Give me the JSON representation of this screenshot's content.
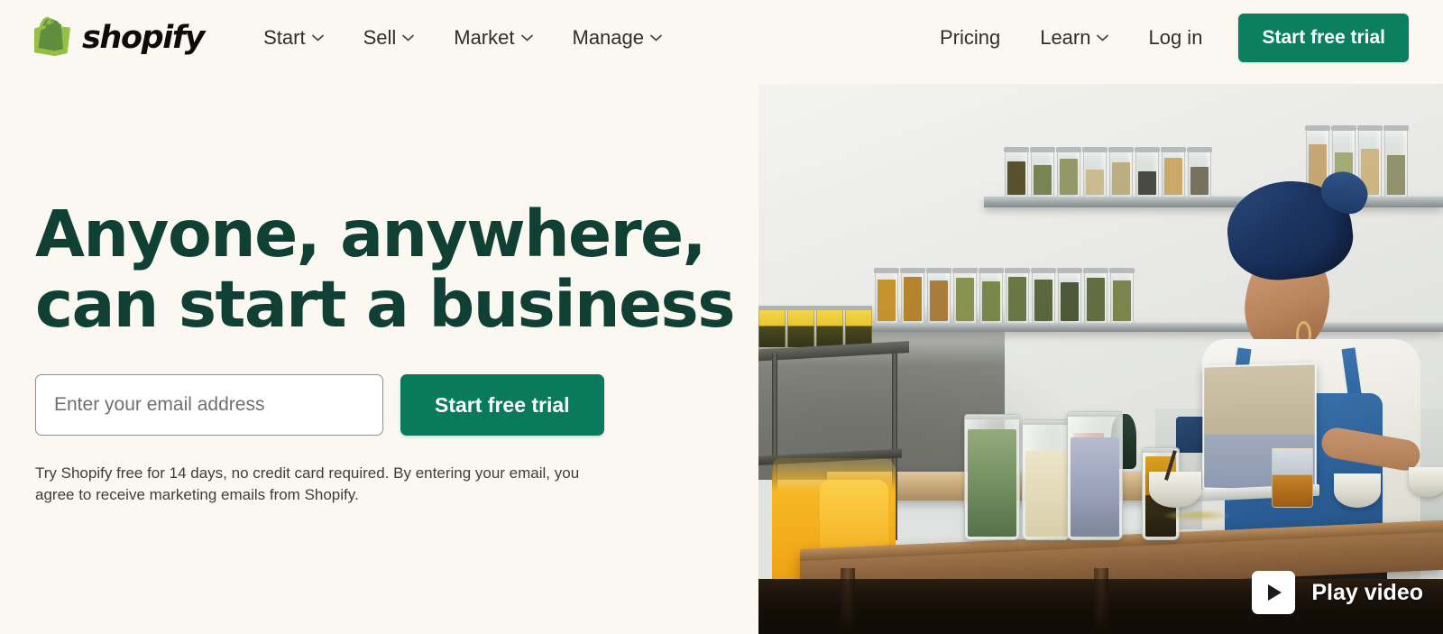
{
  "brand": {
    "name": "shopify",
    "logo_icon": "shopify-bag-icon",
    "accent_green": "#0a8060",
    "hero_button_green": "#0a7a5c",
    "headline_green": "#103f34",
    "page_background": "#faf8f1"
  },
  "nav": {
    "main_items": [
      {
        "label": "Start",
        "has_dropdown": true,
        "icon": "chevron-down-icon"
      },
      {
        "label": "Sell",
        "has_dropdown": true,
        "icon": "chevron-down-icon"
      },
      {
        "label": "Market",
        "has_dropdown": true,
        "icon": "chevron-down-icon"
      },
      {
        "label": "Manage",
        "has_dropdown": true,
        "icon": "chevron-down-icon"
      }
    ],
    "right_items": [
      {
        "label": "Pricing",
        "has_dropdown": false
      },
      {
        "label": "Learn",
        "has_dropdown": true,
        "icon": "chevron-down-icon"
      },
      {
        "label": "Log in",
        "has_dropdown": false
      }
    ],
    "cta_label": "Start free trial"
  },
  "hero": {
    "headline": "Anyone, anywhere,\ncan start a business",
    "email_placeholder": "Enter your email address",
    "email_value": "",
    "cta_label": "Start free trial",
    "fineprint": "Try Shopify free for 14 days, no credit card required. By entering your email, you agree to receive marketing emails from Shopify."
  },
  "media": {
    "play_label": "Play video",
    "play_icon": "play-triangle-icon",
    "alt": "Business owner working on a laptop at a wooden table surrounded by glass jars of dried herbs and preserves"
  }
}
